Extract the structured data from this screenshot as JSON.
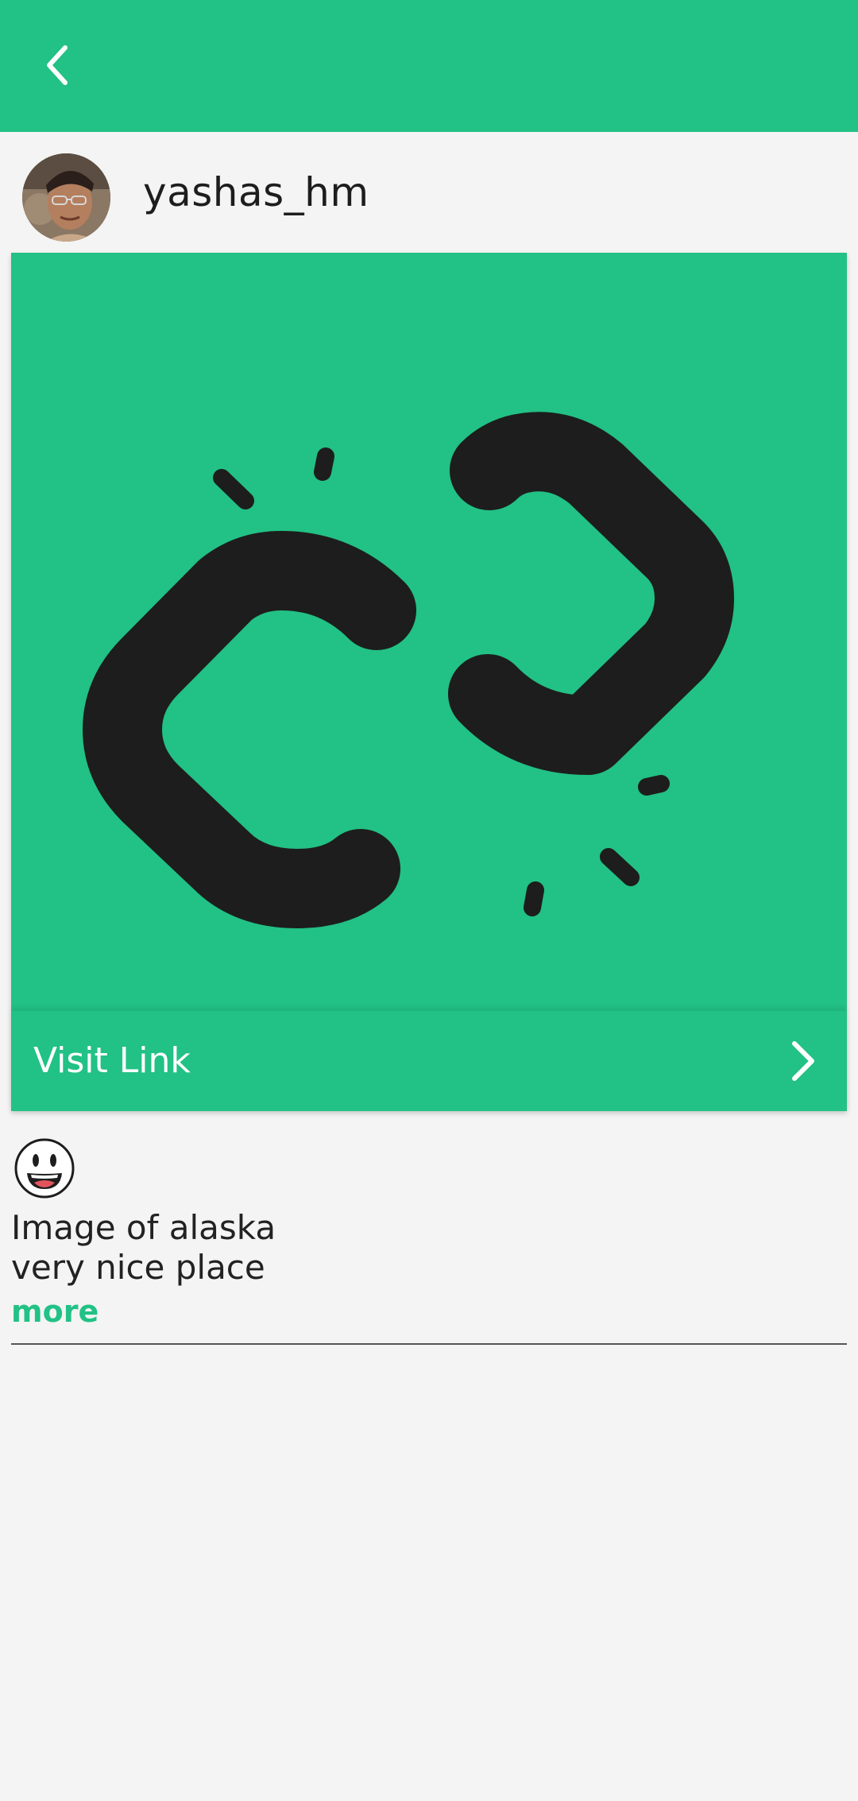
{
  "header": {
    "back_icon": "arrow-back-icon",
    "background": "#22c185"
  },
  "post": {
    "username": "yashas_hm",
    "avatar_icon": "user-avatar",
    "link_preview_icon": "broken-link-icon",
    "visit_link_label": "Visit Link",
    "visit_link_icon": "chevron-right-icon",
    "reaction_icon": "grinning-face-emoji",
    "caption_line1": "Image of alaska",
    "caption_line2": "very nice place",
    "more_label": "more"
  },
  "colors": {
    "accent": "#22c185",
    "background": "#f3f4f3",
    "text": "#1d1d1d"
  }
}
